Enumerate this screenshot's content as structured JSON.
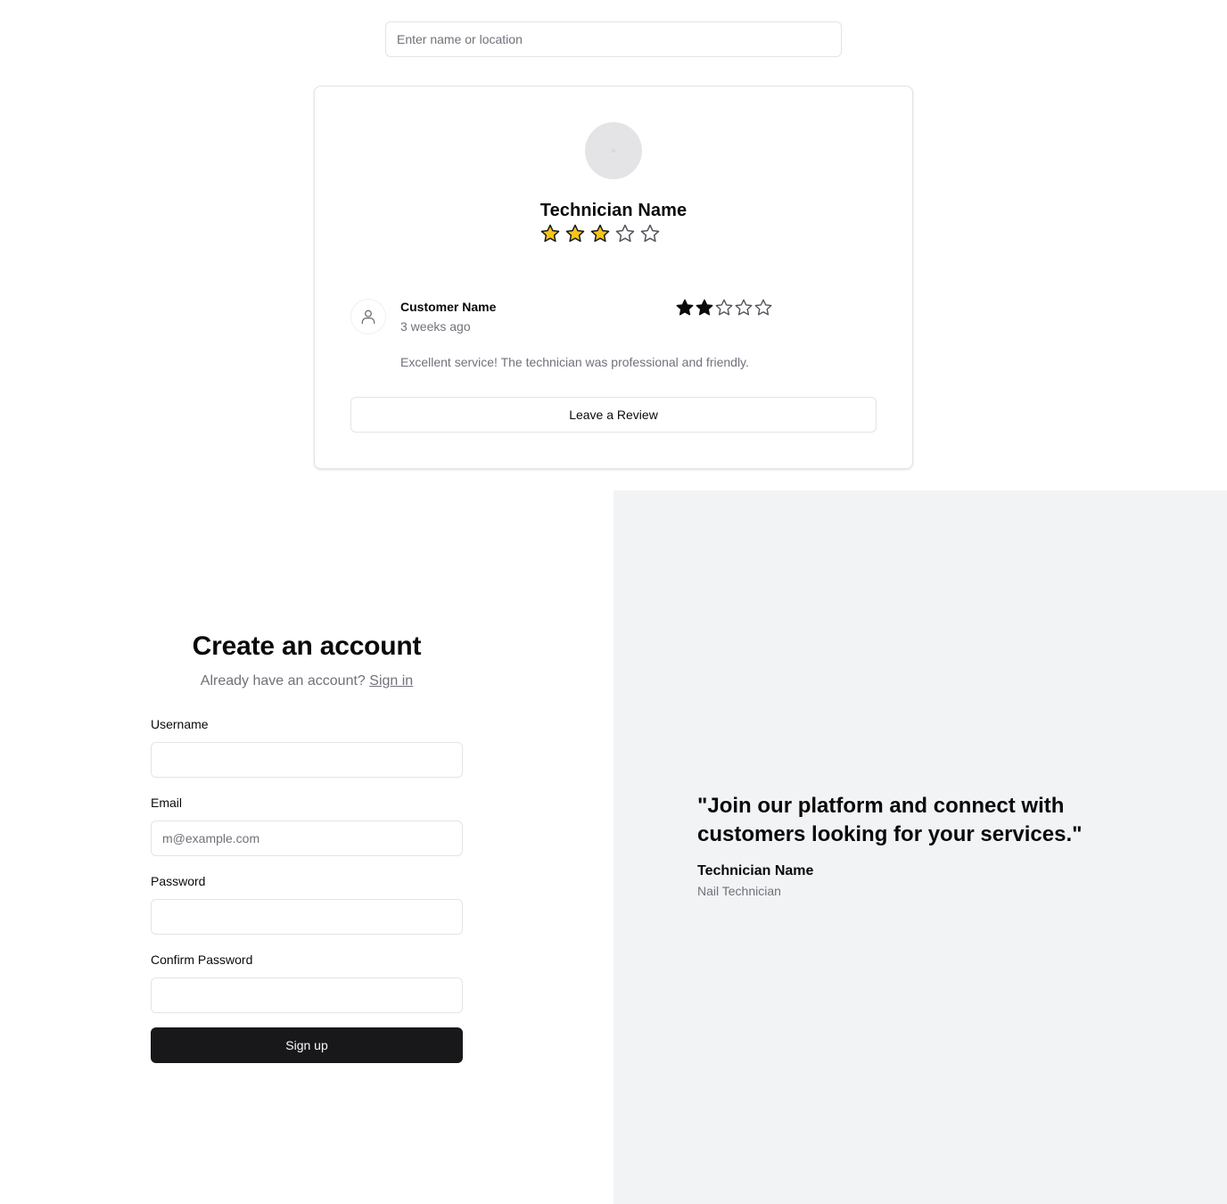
{
  "search": {
    "placeholder": "Enter name or location"
  },
  "technician_card": {
    "name": "Technician Name",
    "rating": 3,
    "max_rating": 5,
    "star_fill_color": "#f5c518",
    "review": {
      "customer_name": "Customer Name",
      "time": "3 weeks ago",
      "rating": 2,
      "max_rating": 5,
      "text": "Excellent service! The technician was professional and friendly."
    },
    "leave_review_label": "Leave a Review"
  },
  "signup": {
    "title": "Create an account",
    "subtitle_prefix": "Already have an account?",
    "sign_in_link": "Sign in",
    "fields": {
      "username": {
        "label": "Username",
        "value": "",
        "placeholder": ""
      },
      "email": {
        "label": "Email",
        "value": "",
        "placeholder": "m@example.com"
      },
      "password": {
        "label": "Password",
        "value": "",
        "placeholder": ""
      },
      "confirm_password": {
        "label": "Confirm Password",
        "value": "",
        "placeholder": ""
      }
    },
    "submit_label": "Sign up"
  },
  "testimonial": {
    "quote": "\"Join our platform and connect with customers looking for your services.\"",
    "name": "Technician Name",
    "role": "Nail Technician"
  }
}
